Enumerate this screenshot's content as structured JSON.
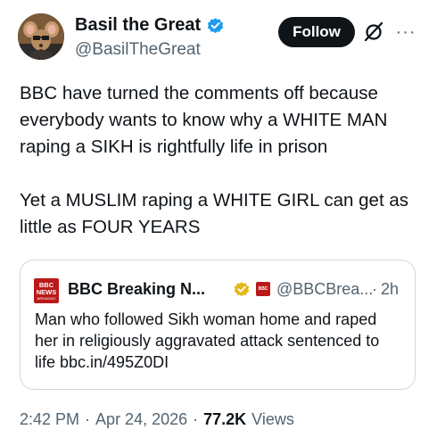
{
  "author": {
    "display_name": "Basil the Great",
    "handle": "@BasilTheGreat",
    "verified": true,
    "avatar_icon": "mouse-detective-avatar"
  },
  "actions": {
    "follow_label": "Follow",
    "grok_icon": "grok-icon",
    "more_label": "···"
  },
  "tweet": {
    "paragraphs": [
      "BBC have turned the comments off because everybody wants to know why a WHITE MAN raping a SIKH is rightfully life in prison",
      "Yet a MUSLIM raping a WHITE GIRL can get as little as FOUR YEARS"
    ]
  },
  "quote": {
    "logo_text": "BBC",
    "logo_line2": "NEWS",
    "logo_line3": "BREAKING",
    "display_name": "BBC Breaking N...",
    "verified_org": true,
    "affiliate_logo_text": "BBC",
    "handle": "@BBCBrea...",
    "separator": "·",
    "time": "2h",
    "text": "Man who followed Sikh woman home and raped her in religiously aggravated attack sentenced to life bbc.in/495Z0DI"
  },
  "meta": {
    "time": "2:42 PM",
    "sep1": "·",
    "date": "Apr 24, 2026",
    "sep2": "·",
    "views_count": "77.2K",
    "views_label": "Views"
  },
  "colors": {
    "text_primary": "#0f1419",
    "text_secondary": "#536471",
    "verified_blue": "#1d9bf0",
    "verified_gold": "#e2b719",
    "bbc_red": "#bb1919",
    "border": "#cfd9de"
  }
}
